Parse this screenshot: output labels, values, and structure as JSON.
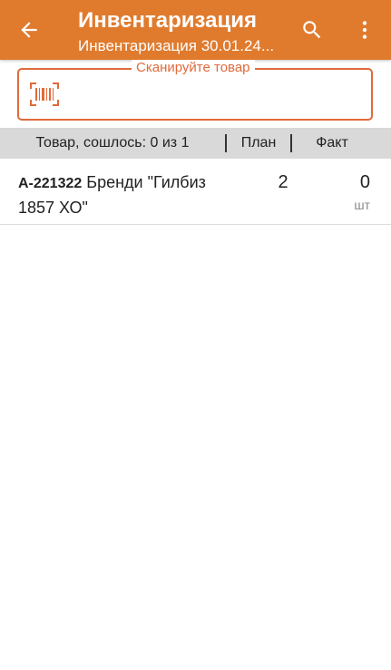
{
  "appbar": {
    "title": "Инвентаризация",
    "subtitle": "Инвентаризация 30.01.24...",
    "back_icon": "arrow-back-icon",
    "search_icon": "search-icon",
    "menu_icon": "more-vert-icon",
    "color": "#e07b2e"
  },
  "scan": {
    "legend": "Сканируйте товар",
    "value": "",
    "icon": "barcode-icon",
    "accent": "#e06a3a"
  },
  "table": {
    "header": {
      "product": "Товар, сошлось: 0 из 1",
      "plan": "План",
      "fact": "Факт"
    },
    "rows": [
      {
        "code": "А-221322",
        "name": " Бренди \"Гилбиз 1857 ХО\"",
        "plan": "2",
        "fact": "0",
        "unit": "шт"
      }
    ]
  }
}
